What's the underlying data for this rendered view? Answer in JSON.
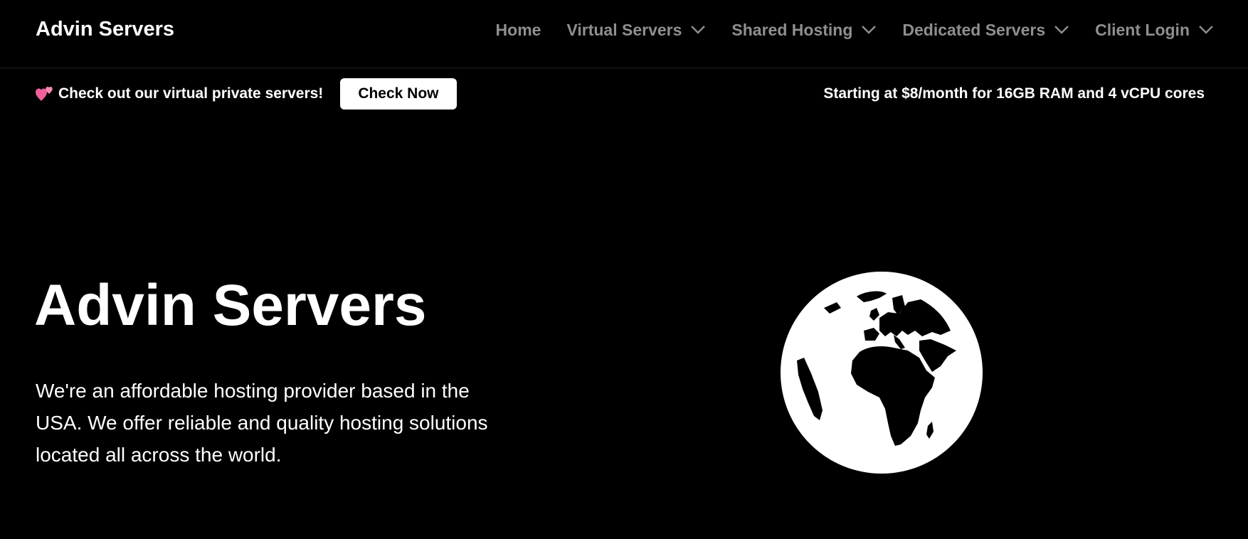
{
  "header": {
    "brand": "Advin Servers",
    "nav": [
      {
        "label": "Home",
        "dropdown": false
      },
      {
        "label": "Virtual Servers",
        "dropdown": true
      },
      {
        "label": "Shared Hosting",
        "dropdown": true
      },
      {
        "label": "Dedicated Servers",
        "dropdown": true
      },
      {
        "label": "Client Login",
        "dropdown": true
      }
    ]
  },
  "promo": {
    "icon": "two-hearts-icon",
    "text": "Check out our virtual private servers!",
    "button_label": "Check Now",
    "pricing": "Starting at $8/month for 16GB RAM and 4 vCPU cores"
  },
  "hero": {
    "title": "Advin Servers",
    "description": "We're an affordable hosting provider based in the USA. We offer reliable and quality hosting solutions located all across the world.",
    "illustration": "globe-icon"
  },
  "colors": {
    "background": "#000000",
    "text": "#ffffff",
    "nav_text": "#8f8f8f",
    "accent_heart": "#f0609a"
  }
}
